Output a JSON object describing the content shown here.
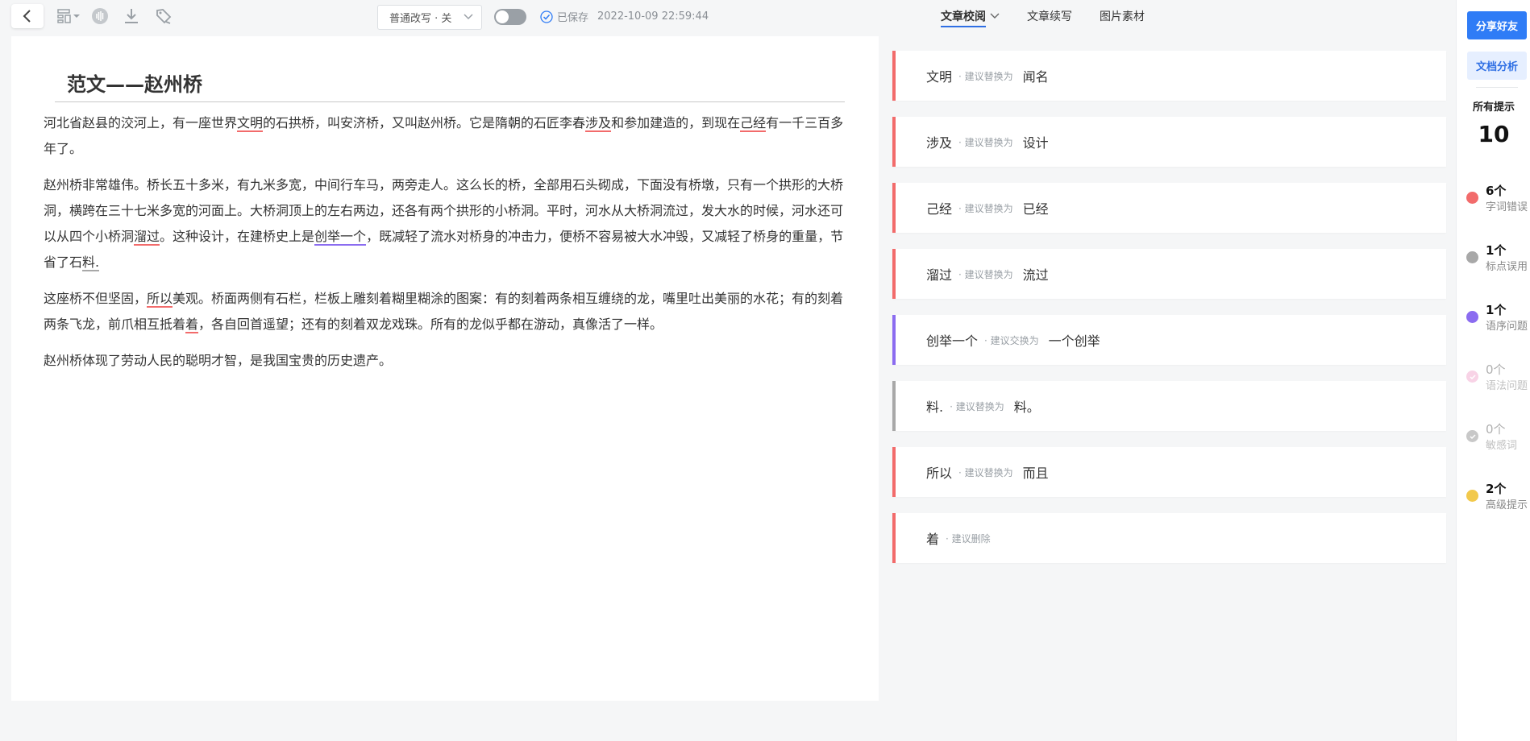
{
  "toolbar": {
    "mode_select": "普通改写 · 关",
    "saved_label": "已保存",
    "saved_time": "2022-10-09 22:59:44",
    "tabs": [
      {
        "label": "文章校阅",
        "active": true
      },
      {
        "label": "文章续写",
        "active": false
      },
      {
        "label": "图片素材",
        "active": false
      }
    ]
  },
  "document": {
    "title": "范文——赵州桥",
    "paragraphs": [
      [
        "河北省赵县的洨河上，有一座世界",
        "文明",
        "的石拱桥，叫安济桥，又叫赵州桥。它是隋朝的石匠李春",
        "涉及",
        "和参加建造的，到现在",
        "己经",
        "有一千三百多年了。"
      ],
      [
        "赵州桥非常雄伟。桥长五十多米，有九米多宽，中间行车马，两旁走人。这么长的桥，全部用石头砌成，下面没有桥墩，只有一个拱形的大桥洞，横跨在三十七米多宽的河面上。大桥洞顶上的左右两边，还各有两个拱形的小桥洞。平时，河水从大桥洞流过，发大水的时候，河水还可以从四个小桥洞",
        "溜过",
        "。这种设计，在建桥史上是",
        "创举一个",
        "，既减轻了流水对桥身的冲击力，便桥不容易被大水冲毁，又减轻了桥身的重量，节省了石",
        "料.",
        ""
      ],
      [
        "这座桥不但坚固，",
        "所以",
        "美观。桥面两侧有石栏，栏板上雕刻着糊里糊涂的图案：有的刻着两条相互缠绕的龙，嘴里吐出美丽的水花；有的刻着两条飞龙，前爪相互抵着",
        "着",
        "，各自回首遥望；还有的刻着双龙戏珠。所有的龙似乎都在游动，真像活了一样。"
      ],
      [
        "赵州桥体现了劳动人民的聪明才智，是我国宝贵的历史遗产。"
      ]
    ]
  },
  "suggestions": [
    {
      "original": "文明",
      "hint": "· 建议替换为",
      "replacement": "闻名",
      "color": "red"
    },
    {
      "original": "涉及",
      "hint": "· 建议替换为",
      "replacement": "设计",
      "color": "red"
    },
    {
      "original": "己经",
      "hint": "· 建议替换为",
      "replacement": "已经",
      "color": "red"
    },
    {
      "original": "溜过",
      "hint": "· 建议替换为",
      "replacement": "流过",
      "color": "red"
    },
    {
      "original": "创举一个",
      "hint": "· 建议交换为",
      "replacement": "一个创举",
      "color": "purple"
    },
    {
      "original": "料.",
      "hint": "· 建议替换为",
      "replacement": "料。",
      "color": "gray"
    },
    {
      "original": "所以",
      "hint": "· 建议替换为",
      "replacement": "而且",
      "color": "red"
    },
    {
      "original": "着",
      "hint": "· 建议删除",
      "replacement": "",
      "color": "red"
    }
  ],
  "rail": {
    "share_button": "分享好友",
    "analysis_button": "文档分析",
    "all_label": "所有提示",
    "all_count": "10",
    "stats": [
      {
        "count": "6个",
        "label": "字词错误",
        "color": "#f26b6b",
        "faded": false
      },
      {
        "count": "1个",
        "label": "标点误用",
        "color": "#a8a8a8",
        "faded": false
      },
      {
        "count": "1个",
        "label": "语序问题",
        "color": "#8b6cf0",
        "faded": false
      },
      {
        "count": "0个",
        "label": "语法问题",
        "color": "#f5c2de",
        "faded": true
      },
      {
        "count": "0个",
        "label": "敏感词",
        "color": "#c8c8c8",
        "faded": true
      },
      {
        "count": "2个",
        "label": "高级提示",
        "color": "#f2c94c",
        "faded": false
      }
    ]
  }
}
